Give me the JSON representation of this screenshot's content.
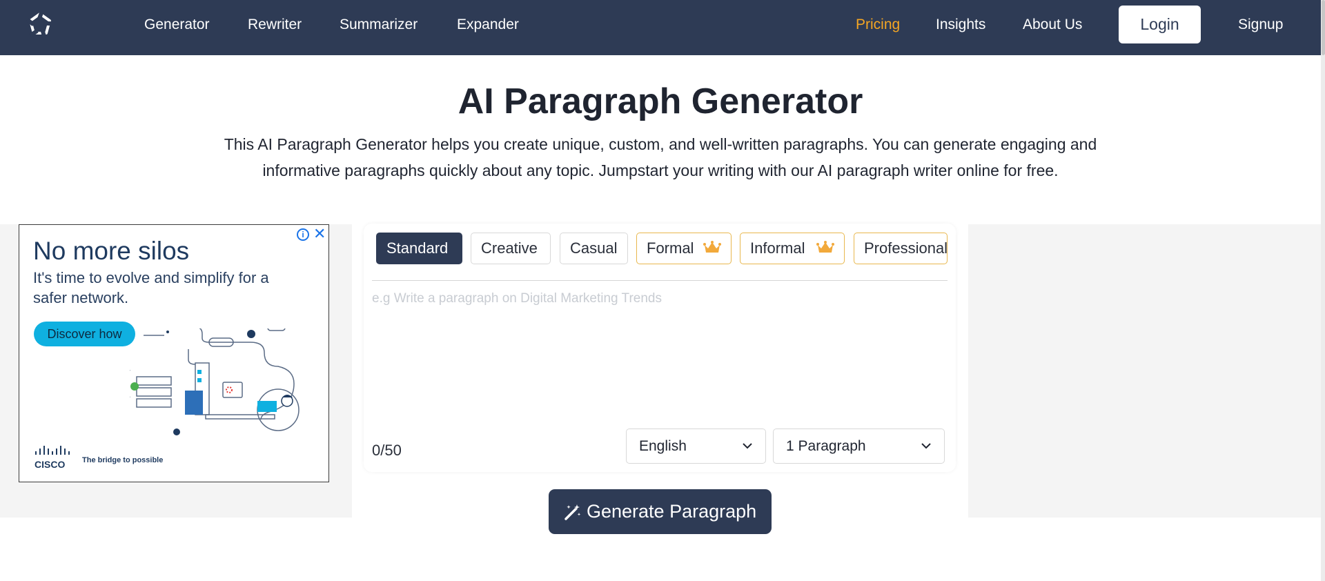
{
  "nav": {
    "logo_icon": "brand-logo-icon",
    "links": [
      "Generator",
      "Rewriter",
      "Summarizer",
      "Expander"
    ],
    "right_links": [
      "Pricing",
      "Insights",
      "About Us"
    ],
    "login_label": "Login",
    "signup_label": "Signup",
    "accent_color": "#f5a623",
    "background_color": "#2e3b55"
  },
  "hero": {
    "title": "AI Paragraph Generator",
    "description_line1": "This AI Paragraph Generator helps you create unique, custom, and well-written paragraphs. You can generate engaging and",
    "description_line2": "informative paragraphs quickly about any topic. Jumpstart your writing with our AI paragraph writer online for free."
  },
  "ad": {
    "headline": "No more silos",
    "subtext": "It's time to evolve and simplify for a safer network.",
    "cta_label": "Discover how",
    "brand_name": "CISCO",
    "tagline": "The bridge to possible",
    "info_icon": "info-icon",
    "close_icon": "close-icon"
  },
  "editor": {
    "tones": [
      {
        "label": "Standard",
        "active": true,
        "premium": false
      },
      {
        "label": "Creative",
        "active": false,
        "premium": false
      },
      {
        "label": "Casual",
        "active": false,
        "premium": false
      },
      {
        "label": "Formal",
        "active": false,
        "premium": true
      },
      {
        "label": "Informal",
        "active": false,
        "premium": true
      },
      {
        "label": "Professional",
        "active": false,
        "premium": false
      }
    ],
    "premium_icon": "crown-icon",
    "prompt_placeholder": "e.g Write a paragraph on Digital Marketing Trends",
    "prompt_value": "",
    "char_count": "0/50",
    "language_value": "English",
    "length_value": "1 Paragraph"
  },
  "generate": {
    "label": "Generate Paragraph",
    "icon": "magic-wand-icon"
  }
}
